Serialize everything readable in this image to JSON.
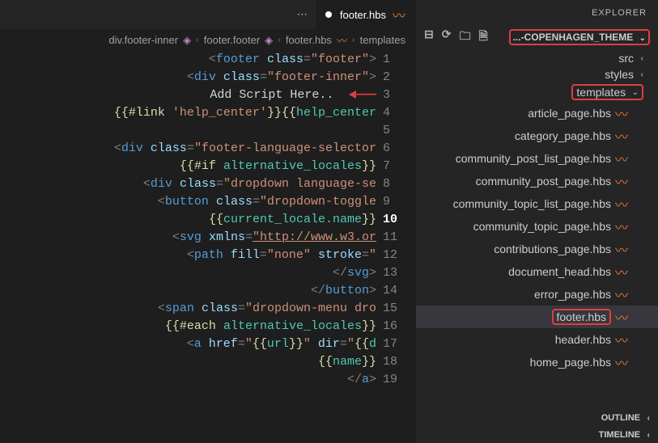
{
  "explorer": {
    "title": "EXPLORER",
    "project": "COPENHAGEN_THEME-...",
    "folders": {
      "src": "src",
      "styles": "styles",
      "templates": "templates"
    },
    "files": [
      "article_page.hbs",
      "category_page.hbs",
      "community_post_list_page.hbs",
      "community_post_page.hbs",
      "community_topic_list_page.hbs",
      "community_topic_page.hbs",
      "contributions_page.hbs",
      "document_head.hbs",
      "error_page.hbs",
      "footer.hbs",
      "header.hbs",
      "home_page.hbs"
    ],
    "active_file": "footer.hbs",
    "sections": {
      "outline": "OUTLINE",
      "timeline": "TIMELINE"
    }
  },
  "tab": {
    "label": "footer.hbs",
    "modified": true
  },
  "breadcrumb": {
    "parts": [
      "templates",
      "footer.hbs",
      "footer.footer",
      "div.footer-inner"
    ]
  },
  "editor": {
    "annotation_line": 3,
    "annotation_text": "Add Script Here..",
    "lines": [
      {
        "n": 1,
        "html": "<span class='tok-punct'>&lt;</span><span class='tok-tag'>footer</span> <span class='tok-attr'>class</span><span class='tok-punct'>=</span><span class='tok-str'>\"footer\"</span><span class='tok-punct'>&gt;</span>"
      },
      {
        "n": 2,
        "html": "  <span class='tok-punct'>&lt;</span><span class='tok-tag'>div</span> <span class='tok-attr'>class</span><span class='tok-punct'>=</span><span class='tok-str'>\"footer-inner\"</span><span class='tok-punct'>&gt;</span>"
      },
      {
        "n": 3,
        "html": "    <span class='tok-text'>Add Script Here..</span>  <span class='arrow-head'></span><span class='arrow'>———</span>"
      },
      {
        "n": 4,
        "html": "    <span class='tok-hbs'>{{#link</span> <span class='tok-str'>'help_center'</span><span class='tok-hbs'>}}</span><span class='tok-hbs'>{{</span><span class='tok-hbs2'>help_center</span>"
      },
      {
        "n": 5,
        "html": ""
      },
      {
        "n": 6,
        "html": "    <span class='tok-punct'>&lt;</span><span class='tok-tag'>div</span> <span class='tok-attr'>class</span><span class='tok-punct'>=</span><span class='tok-str'>\"footer-language-selector</span>"
      },
      {
        "n": 7,
        "html": "      <span class='tok-hbs'>{{#if</span> <span class='tok-hbs2'>alternative_locales</span><span class='tok-hbs'>}}</span>"
      },
      {
        "n": 8,
        "html": "      <span class='tok-punct'>&lt;</span><span class='tok-tag'>div</span> <span class='tok-attr'>class</span><span class='tok-punct'>=</span><span class='tok-str'>\"dropdown language-se</span>"
      },
      {
        "n": 9,
        "html": "        <span class='tok-punct'>&lt;</span><span class='tok-tag'>button</span> <span class='tok-attr'>class</span><span class='tok-punct'>=</span><span class='tok-str'>\"dropdown-toggle</span>"
      },
      {
        "n": 10,
        "html": "          <span class='tok-hbs'>{{</span><span class='tok-hbs2'>current_locale.name</span><span class='tok-hbs'>}}</span>"
      },
      {
        "n": 11,
        "html": "          <span class='tok-punct'>&lt;</span><span class='tok-tag'>svg</span> <span class='tok-attr'>xmlns</span><span class='tok-punct'>=</span><span class='tok-str' style='text-decoration: underline'>\"http://www.w3.or</span>"
      },
      {
        "n": 12,
        "html": "            <span class='tok-punct'>&lt;</span><span class='tok-tag'>path</span> <span class='tok-attr'>fill</span><span class='tok-punct'>=</span><span class='tok-str'>\"none\"</span> <span class='tok-attr'>stroke</span><span class='tok-punct'>=</span><span class='tok-str'>\"</span>"
      },
      {
        "n": 13,
        "html": "          <span class='tok-punct'>&lt;/</span><span class='tok-tag'>svg</span><span class='tok-punct'>&gt;</span>"
      },
      {
        "n": 14,
        "html": "        <span class='tok-punct'>&lt;/</span><span class='tok-tag'>button</span><span class='tok-punct'>&gt;</span>"
      },
      {
        "n": 15,
        "html": "        <span class='tok-punct'>&lt;</span><span class='tok-tag'>span</span> <span class='tok-attr'>class</span><span class='tok-punct'>=</span><span class='tok-str'>\"dropdown-menu dro</span>"
      },
      {
        "n": 16,
        "html": "          <span class='tok-hbs'>{{#each</span> <span class='tok-hbs2'>alternative_locales</span><span class='tok-hbs'>}}</span>"
      },
      {
        "n": 17,
        "html": "            <span class='tok-punct'>&lt;</span><span class='tok-tag'>a</span> <span class='tok-attr'>href</span><span class='tok-punct'>=</span><span class='tok-str'>\"</span><span class='tok-hbs'>{{</span><span class='tok-hbs2'>url</span><span class='tok-hbs'>}}</span><span class='tok-str'>\"</span> <span class='tok-attr'>dir</span><span class='tok-punct'>=</span><span class='tok-str'>\"</span><span class='tok-hbs'>{{</span><span class='tok-hbs2'>d</span>"
      },
      {
        "n": 18,
        "html": "              <span class='tok-hbs'>{{</span><span class='tok-hbs2'>name</span><span class='tok-hbs'>}}</span>"
      },
      {
        "n": 19,
        "html": "            <span class='tok-punct'>&lt;/</span><span class='tok-tag'>a</span><span class='tok-punct'>&gt;</span>"
      }
    ]
  }
}
